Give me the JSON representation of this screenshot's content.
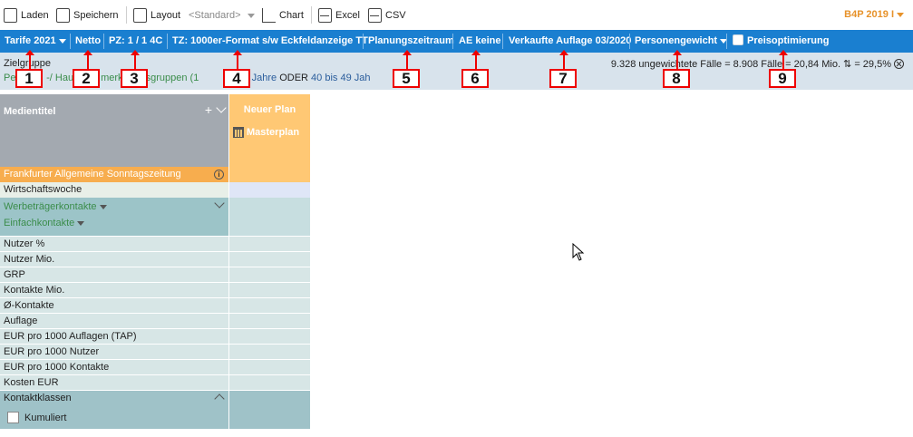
{
  "toolbar": {
    "load": "Laden",
    "save": "Speichern",
    "layout": "Layout",
    "layout_value": "<Standard>",
    "chart": "Chart",
    "excel": "Excel",
    "csv": "CSV",
    "brand": "B4P 2019 I"
  },
  "filterbar": {
    "tarife": "Tarife 2021",
    "netto": "Netto",
    "pz": "PZ: 1 / 1 4C",
    "tz": "TZ: 1000er-Format s/w Eckfeldanzeige TT",
    "planung": "Planungszeitraum",
    "ae": "AE keine",
    "auflage": "Verkaufte Auflage 03/2020",
    "gewicht": "Personengewicht",
    "preis": "Preisoptimierung"
  },
  "targetgroup": {
    "title": "Zielgruppe",
    "part1": "Per",
    "part2": "-/ Hau",
    "part3": "merk",
    "part4": " Altersgruppen (1",
    "part5": "is 39 Jahre",
    "oder": " ODER ",
    "part6": "40 bis 49 Jah",
    "stats": "9.328 ungewichtete Fälle = 8.908 Fälle = 20,84 Mio. ⇅ = 29,5%"
  },
  "badges": [
    "1",
    "2",
    "3",
    "4",
    "5",
    "6",
    "7",
    "8",
    "9"
  ],
  "table": {
    "medien_header": "Medientitel",
    "plan_header": "Neuer Plan",
    "masterplan": "Masterplan",
    "rows": [
      "Frankfurter Allgemeine Sonntagszeitung",
      "Wirtschaftswoche"
    ],
    "werbetraeger": "Werbeträgerkontakte",
    "einfach": "Einfachkontakte",
    "metrics": [
      "Nutzer %",
      "Nutzer Mio.",
      "GRP",
      "Kontakte Mio.",
      "Ø-Kontakte",
      "Auflage",
      "EUR pro 1000 Auflagen (TAP)",
      "EUR pro 1000 Nutzer",
      "EUR pro 1000 Kontakte",
      "Kosten EUR"
    ],
    "kontaktklassen": "Kontaktklassen",
    "kumuliert": "Kumuliert"
  },
  "colors": {
    "filterbar": "#1a7fd0",
    "brand": "#e7922a",
    "plan_header": "#ffc874",
    "highlight_row": "#f7ad4e",
    "badge_border": "#e00000"
  }
}
